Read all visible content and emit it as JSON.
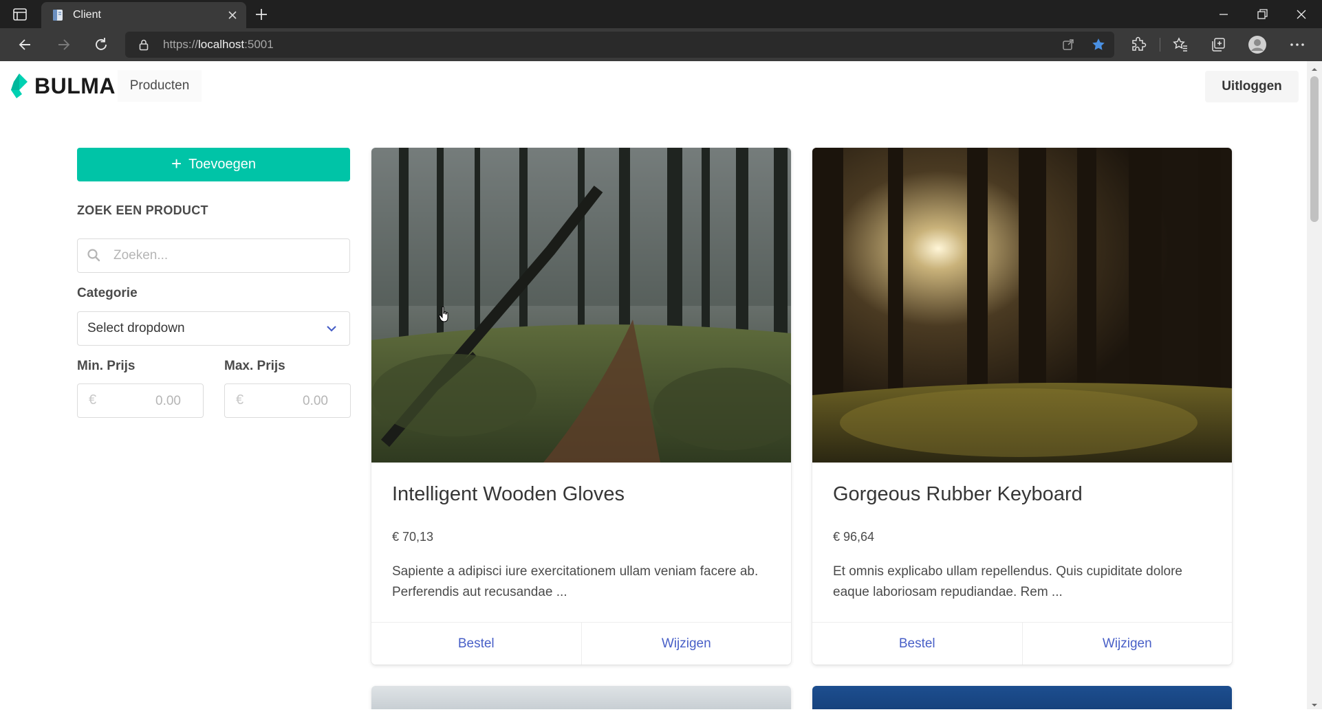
{
  "browser": {
    "tab_title": "Client",
    "url_prefix": "https://",
    "url_host": "localhost",
    "url_suffix": ":5001",
    "bookmark_star_color": "#4a90e2"
  },
  "navbar": {
    "brand": "BULMA",
    "brand_color": "#00d1b2",
    "nav_item": "Producten",
    "logout_label": "Uitloggen"
  },
  "sidebar": {
    "add_label": "Toevoegen",
    "search_title": "ZOEK EEN PRODUCT",
    "search_placeholder": "Zoeken...",
    "category_label": "Categorie",
    "category_value": "Select dropdown",
    "min_price_label": "Min. Prijs",
    "max_price_label": "Max. Prijs",
    "currency_symbol": "€",
    "min_price_placeholder": "0.00",
    "max_price_placeholder": "0.00"
  },
  "products": [
    {
      "title": "Intelligent Wooden Gloves",
      "price": "€ 70,13",
      "description": "Sapiente a adipisci iure exercitationem ullam veniam facere ab. Perferendis aut recusandae ...",
      "image": "forest-path-photo",
      "order_label": "Bestel",
      "edit_label": "Wijzigen"
    },
    {
      "title": "Gorgeous Rubber Keyboard",
      "price": "€ 96,64",
      "description": "Et omnis explicabo ullam repellendus. Quis cupiditate dolore eaque laboriosam repudiandae. Rem ...",
      "image": "sunlit-forest-photo",
      "order_label": "Bestel",
      "edit_label": "Wijzigen"
    }
  ],
  "colors": {
    "primary": "#00c4a7",
    "link": "#485fc7"
  }
}
